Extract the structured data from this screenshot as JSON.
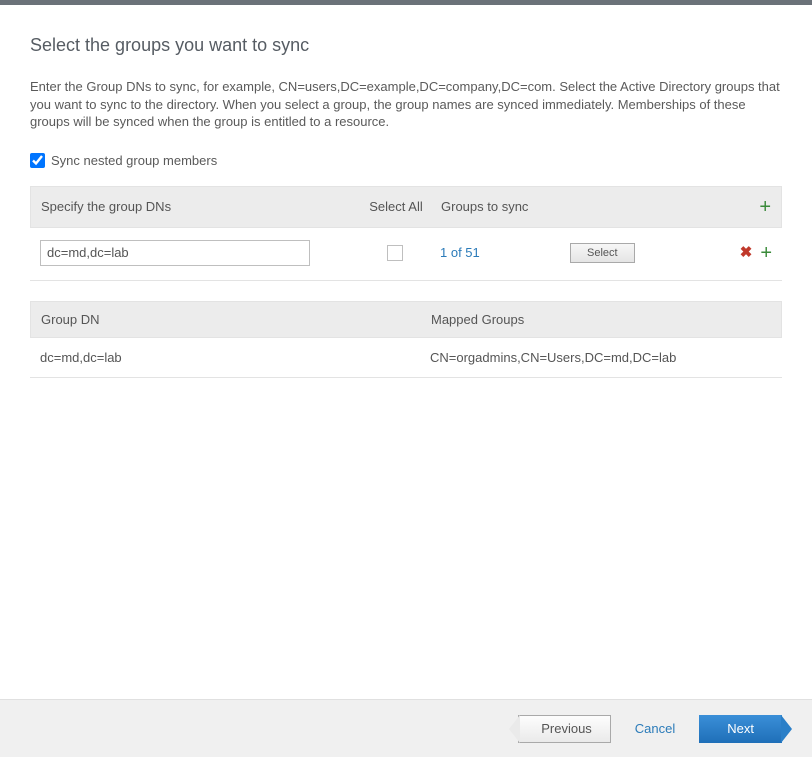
{
  "title": "Select the groups you want to sync",
  "description": "Enter the Group DNs to sync, for example, CN=users,DC=example,DC=company,DC=com. Select the Active Directory groups that you want to sync to the directory. When you select a group, the group names are synced immediately. Memberships of these groups will be synced when the group is entitled to a resource.",
  "nested_checkbox_label": "Sync nested group members",
  "nested_checked": true,
  "headers": {
    "specify": "Specify the group DNs",
    "select_all": "Select All",
    "groups_to_sync": "Groups to sync"
  },
  "row": {
    "dn_value": "dc=md,dc=lab",
    "groups_link": "1 of 51",
    "select_btn": "Select"
  },
  "mapping_headers": {
    "group_dn": "Group DN",
    "mapped_groups": "Mapped Groups"
  },
  "mapping_row": {
    "dn": "dc=md,dc=lab",
    "mapped": "CN=orgadmins,CN=Users,DC=md,DC=lab"
  },
  "footer": {
    "previous": "Previous",
    "cancel": "Cancel",
    "next": "Next"
  }
}
